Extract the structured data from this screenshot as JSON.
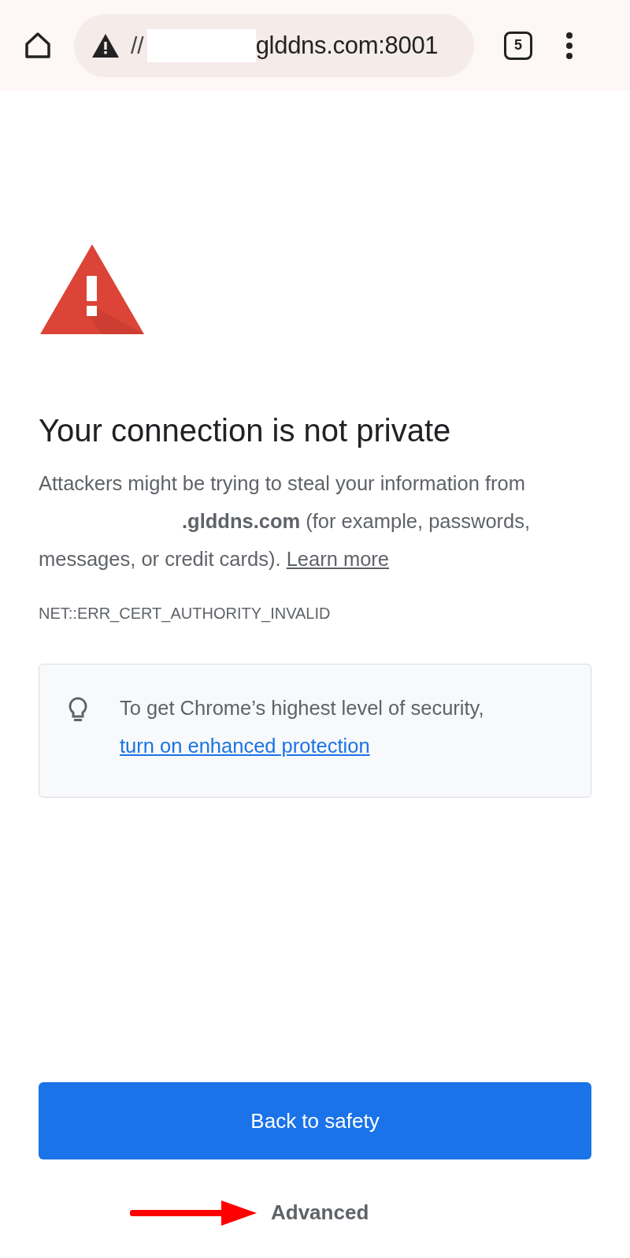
{
  "toolbar": {
    "url_prefix": "//",
    "url_host": "glddns.com:8001",
    "tab_count": "5"
  },
  "page": {
    "title": "Your connection is not private",
    "text_before": "Attackers might be trying to steal your information from",
    "text_after": "**.glddns.com** (for example, passwords, messages, or credit cards).",
    "learn_more": "Learn more",
    "error_code": "NET::ERR_CERT_AUTHORITY_INVALID",
    "tip_text": "To get Chrome’s highest level of security,",
    "tip_link": "turn on enhanced protection",
    "primary_button": "Back to safety",
    "advanced_button": "Advanced"
  }
}
